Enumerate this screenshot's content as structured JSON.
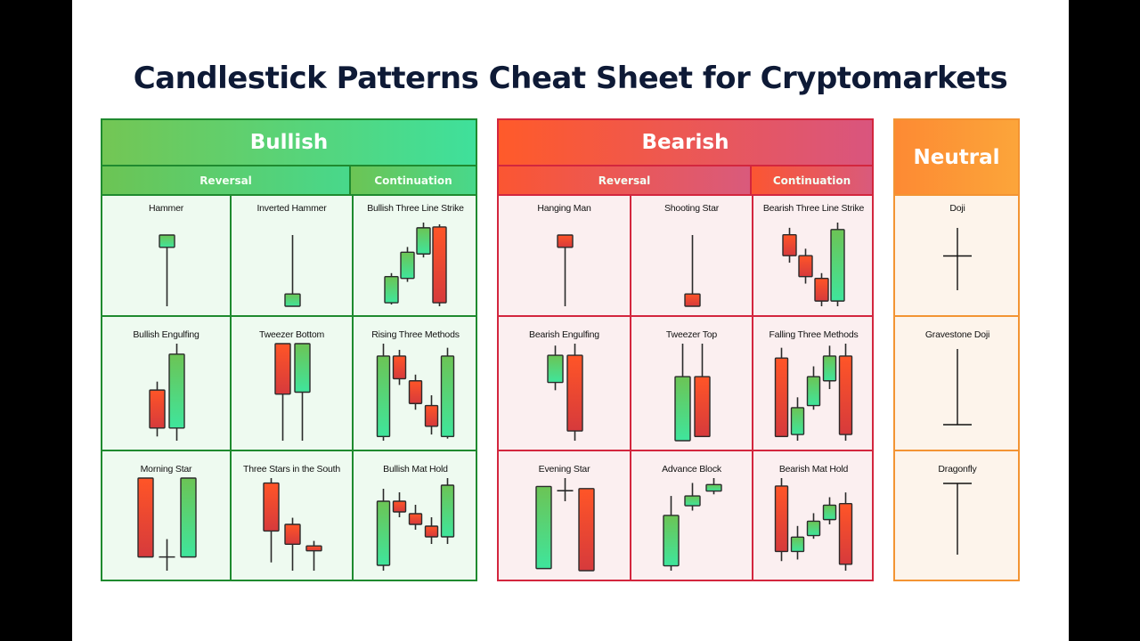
{
  "title": "Candlestick Patterns Cheat Sheet for Cryptomarkets",
  "colors": {
    "bull_top": "#6cc455",
    "bull_bottom": "#3fe59c",
    "bear_top": "#ff5527",
    "bear_bottom": "#d63a3c",
    "wick": "#2a2a2a",
    "bullish_border": "#1f8a2f",
    "bearish_border": "#d3263e",
    "neutral_border": "#f39433"
  },
  "sections": {
    "bullish": {
      "label": "Bullish",
      "reversal_label": "Reversal",
      "continuation_label": "Continuation",
      "patterns": [
        {
          "name": "Hammer",
          "group": "Reversal",
          "candles": [
            {
              "o": 78,
              "c": 88,
              "h": 88,
              "l": 30
            }
          ]
        },
        {
          "name": "Inverted Hammer",
          "group": "Reversal",
          "candles": [
            {
              "o": 22,
              "c": 32,
              "h": 80,
              "l": 22
            }
          ]
        },
        {
          "name": "Bullish Three Line Strike",
          "group": "Continuation",
          "candles": [
            {
              "o": 10,
              "c": 40,
              "h": 44,
              "l": 8
            },
            {
              "o": 38,
              "c": 68,
              "h": 74,
              "l": 34
            },
            {
              "o": 66,
              "c": 96,
              "h": 102,
              "l": 62
            },
            {
              "o": 97,
              "c": 10,
              "h": 100,
              "l": 6
            }
          ]
        },
        {
          "name": "Bullish Engulfing",
          "group": "Reversal",
          "candles": [
            {
              "o": 70,
              "c": 34,
              "h": 78,
              "l": 26
            },
            {
              "o": 34,
              "c": 104,
              "h": 114,
              "l": 22
            }
          ]
        },
        {
          "name": "Tweezer Bottom",
          "group": "Reversal",
          "candles": [
            {
              "o": 100,
              "c": 48,
              "h": 100,
              "l": 0
            },
            {
              "o": 50,
              "c": 100,
              "h": 100,
              "l": 0
            }
          ]
        },
        {
          "name": "Rising Three Methods",
          "group": "Continuation",
          "candles": [
            {
              "o": 30,
              "c": 108,
              "h": 120,
              "l": 26
            },
            {
              "o": 108,
              "c": 86,
              "h": 114,
              "l": 80
            },
            {
              "o": 84,
              "c": 62,
              "h": 90,
              "l": 56
            },
            {
              "o": 60,
              "c": 40,
              "h": 70,
              "l": 32
            },
            {
              "o": 30,
              "c": 108,
              "h": 116,
              "l": 28
            }
          ]
        },
        {
          "name": "Morning Star",
          "group": "Reversal",
          "candles": [
            {
              "o": 90,
              "c": 15,
              "h": 90,
              "l": 15
            },
            {
              "o": 15,
              "c": 15,
              "h": 32,
              "l": 2
            },
            {
              "o": 15,
              "c": 90,
              "h": 90,
              "l": 15
            }
          ]
        },
        {
          "name": "Three Stars in the South",
          "group": "Reversal",
          "candles": [
            {
              "o": 110,
              "c": 52,
              "h": 116,
              "l": 14
            },
            {
              "o": 60,
              "c": 36,
              "h": 68,
              "l": 4
            },
            {
              "o": 34,
              "c": 28,
              "h": 40,
              "l": 4
            }
          ]
        },
        {
          "name": "Bullish Mat Hold",
          "group": "Continuation",
          "candles": [
            {
              "o": 18,
              "c": 90,
              "h": 104,
              "l": 12
            },
            {
              "o": 90,
              "c": 78,
              "h": 100,
              "l": 72
            },
            {
              "o": 76,
              "c": 64,
              "h": 86,
              "l": 58
            },
            {
              "o": 62,
              "c": 50,
              "h": 72,
              "l": 42
            },
            {
              "o": 50,
              "c": 108,
              "h": 116,
              "l": 42
            }
          ]
        }
      ]
    },
    "bearish": {
      "label": "Bearish",
      "reversal_label": "Reversal",
      "continuation_label": "Continuation",
      "patterns": [
        {
          "name": "Hanging Man",
          "group": "Reversal",
          "candles": [
            {
              "o": 88,
              "c": 78,
              "h": 88,
              "l": 30
            }
          ]
        },
        {
          "name": "Shooting Star",
          "group": "Reversal",
          "candles": [
            {
              "o": 32,
              "c": 22,
              "h": 80,
              "l": 22
            }
          ]
        },
        {
          "name": "Bearish Three Line Strike",
          "group": "Continuation",
          "candles": [
            {
              "o": 96,
              "c": 72,
              "h": 104,
              "l": 64
            },
            {
              "o": 72,
              "c": 48,
              "h": 80,
              "l": 40
            },
            {
              "o": 46,
              "c": 20,
              "h": 52,
              "l": 14
            },
            {
              "o": 20,
              "c": 102,
              "h": 110,
              "l": 14
            }
          ]
        },
        {
          "name": "Bearish Engulfing",
          "group": "Reversal",
          "candles": [
            {
              "o": 70,
              "c": 98,
              "h": 108,
              "l": 62
            },
            {
              "o": 98,
              "c": 20,
              "h": 110,
              "l": 10
            }
          ]
        },
        {
          "name": "Tweezer Top",
          "group": "Reversal",
          "candles": [
            {
              "o": 10,
              "c": 72,
              "h": 104,
              "l": 10
            },
            {
              "o": 72,
              "c": 14,
              "h": 104,
              "l": 14
            }
          ]
        },
        {
          "name": "Falling Three Methods",
          "group": "Continuation",
          "candles": [
            {
              "o": 100,
              "c": 24,
              "h": 110,
              "l": 24
            },
            {
              "o": 26,
              "c": 52,
              "h": 62,
              "l": 20
            },
            {
              "o": 54,
              "c": 82,
              "h": 92,
              "l": 50
            },
            {
              "o": 78,
              "c": 102,
              "h": 112,
              "l": 70
            },
            {
              "o": 102,
              "c": 26,
              "h": 114,
              "l": 20
            }
          ]
        },
        {
          "name": "Evening Star",
          "group": "Reversal",
          "candles": [
            {
              "o": 20,
              "c": 98,
              "h": 98,
              "l": 20
            },
            {
              "o": 94,
              "c": 94,
              "h": 106,
              "l": 84
            },
            {
              "o": 96,
              "c": 18,
              "h": 96,
              "l": 18
            }
          ]
        },
        {
          "name": "Advance Block",
          "group": "Reversal",
          "candles": [
            {
              "o": 8,
              "c": 70,
              "h": 94,
              "l": 2
            },
            {
              "o": 82,
              "c": 94,
              "h": 110,
              "l": 76
            },
            {
              "o": 100,
              "c": 108,
              "h": 116,
              "l": 96
            }
          ]
        },
        {
          "name": "Bearish Mat Hold",
          "group": "Continuation",
          "candles": [
            {
              "o": 110,
              "c": 28,
              "h": 120,
              "l": 16
            },
            {
              "o": 28,
              "c": 46,
              "h": 60,
              "l": 18
            },
            {
              "o": 48,
              "c": 66,
              "h": 76,
              "l": 44
            },
            {
              "o": 68,
              "c": 86,
              "h": 96,
              "l": 62
            },
            {
              "o": 88,
              "c": 12,
              "h": 102,
              "l": 4
            }
          ]
        }
      ]
    },
    "neutral": {
      "label": "Neutral",
      "patterns": [
        {
          "name": "Doji",
          "shape": "cross",
          "open_close_level": 0.55
        },
        {
          "name": "Gravestone Doji",
          "shape": "inverted-t",
          "open_close_level": 0.0
        },
        {
          "name": "Dragonfly",
          "shape": "t",
          "open_close_level": 1.0
        }
      ]
    }
  }
}
